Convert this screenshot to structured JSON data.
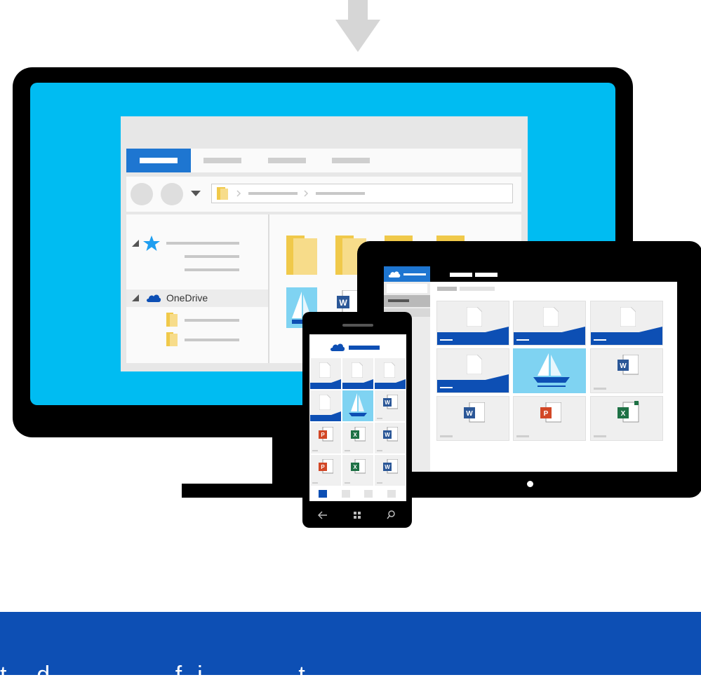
{
  "explorer": {
    "tree_onedrive_label": "OneDrive"
  },
  "banner": {
    "text": "t    d                 f  i             t"
  },
  "icons": {
    "arrow": "arrow-down-icon",
    "cloud": "onedrive-cloud-icon",
    "star": "favorites-star-icon",
    "folder": "folder-icon",
    "word": "word-icon",
    "excel": "excel-icon",
    "powerpoint": "powerpoint-icon"
  },
  "colors": {
    "screen": "#00bcf2",
    "accent_blue": "#1e76d1",
    "dark_blue": "#0d4fb4",
    "banner": "#0d4fb4",
    "word": "#2b5797",
    "excel": "#1e7145",
    "powerpoint": "#d24726"
  },
  "word_letter": "W",
  "excel_letter": "X",
  "powerpoint_letter": "P"
}
